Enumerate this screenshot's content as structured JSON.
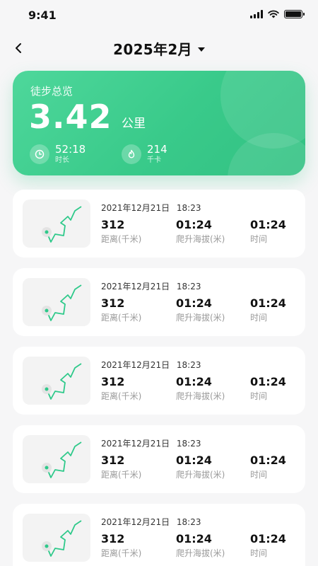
{
  "status_bar": {
    "time": "9:41"
  },
  "header": {
    "title": "2025年2月"
  },
  "summary": {
    "label": "徒步总览",
    "distance": "3.42",
    "unit": "公里",
    "duration_value": "52:18",
    "duration_label": "时长",
    "calories_value": "214",
    "calories_label": "千卡"
  },
  "records": [
    {
      "date": "2021年12月21日 18:23",
      "distance": "312",
      "distance_label": "距离(千米)",
      "climb": "01:24",
      "climb_label": "爬升海拔(米)",
      "time": "01:24",
      "time_label": "时间"
    },
    {
      "date": "2021年12月21日 18:23",
      "distance": "312",
      "distance_label": "距离(千米)",
      "climb": "01:24",
      "climb_label": "爬升海拔(米)",
      "time": "01:24",
      "time_label": "时间"
    },
    {
      "date": "2021年12月21日 18:23",
      "distance": "312",
      "distance_label": "距离(千米)",
      "climb": "01:24",
      "climb_label": "爬升海拔(米)",
      "time": "01:24",
      "time_label": "时间"
    },
    {
      "date": "2021年12月21日 18:23",
      "distance": "312",
      "distance_label": "距离(千米)",
      "climb": "01:24",
      "climb_label": "爬升海拔(米)",
      "time": "01:24",
      "time_label": "时间"
    },
    {
      "date": "2021年12月21日 18:23",
      "distance": "312",
      "distance_label": "距离(千米)",
      "climb": "01:24",
      "climb_label": "爬升海拔(米)",
      "time": "01:24",
      "time_label": "时间"
    }
  ],
  "colors": {
    "accent": "#3ccc8c",
    "route": "#2ec98a"
  }
}
